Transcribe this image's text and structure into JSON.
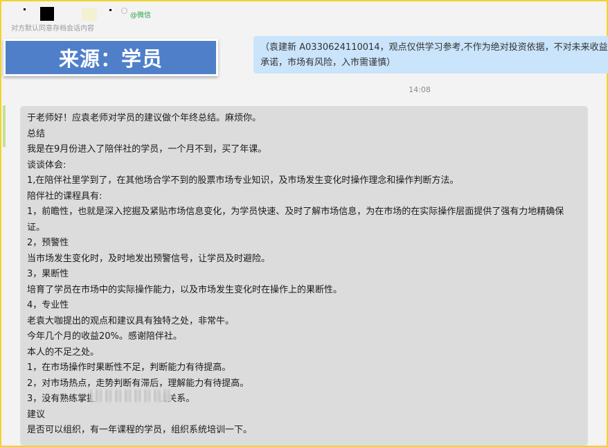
{
  "header": {
    "wechat_tag": "@微信",
    "consent_notice": "对方默认同意存档会话内容"
  },
  "source_badge": "来源：学员",
  "sent_message": "（袁建新 A0330624110014，观点仅供学习参考,不作为绝对投资依据，不对未来收益承诺，市场有风险，入市需谨慎）",
  "timestamp": "14:08",
  "received_message": {
    "lines": [
      "于老师好！应袁老师对学员的建议做个年终总结。麻烦你。",
      "总结",
      "我是在9月份进入了陪伴社的学员，一个月不到，买了年课。",
      "谈谈体会:",
      "1,在陪伴社里学到了，在其他场合学不到的股票市场专业知识，及市场发生变化时操作理念和操作判断方法。",
      "陪伴社的课程具有:",
      "1，前瞻性，也就是深入挖掘及紧贴市场信息变化，为学员快速、及时了解市场信息，为在市场的在实际操作层面提供了强有力地精确保证。",
      "2，预警性",
      "当市场发生变化时，及时地发出预警信号，让学员及时避险。",
      "3，果断性",
      "培育了学员在市场中的实际操作能力，以及市场发生变化时在操作上的果断性。",
      "4，专业性",
      "老袁大咖提出的观点和建议具有独特之处，非常牛。",
      "今年几个月的收益20%。感谢陪伴社。",
      "本人的不足之处。",
      "1，在市场操作时果断性不足，判断能力有待提高。",
      "2，对市场热点，走势判断有滞后，理解能力有待提高。",
      "3，没有熟练掌握　　　　　　　辑关系。",
      "建议",
      "是否可以组织，有一年课程的学员，组织系统培训一下。"
    ]
  }
}
